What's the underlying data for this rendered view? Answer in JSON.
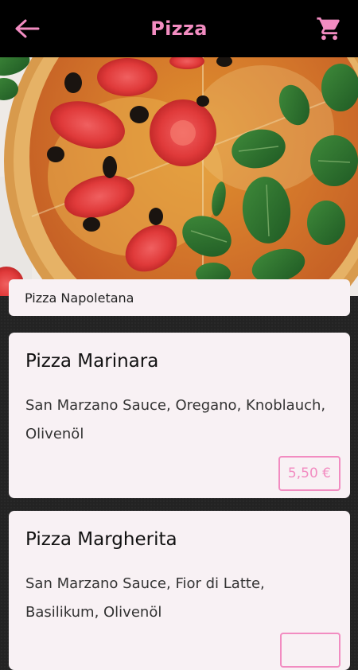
{
  "header": {
    "title": "Pizza",
    "back_icon": "arrow-left-icon",
    "cart_icon": "shopping-cart-icon",
    "accent_color": "#f28cc1"
  },
  "hero": {
    "caption": "Pizza Napoletana"
  },
  "menu": [
    {
      "name": "Pizza Marinara",
      "description": "San Marzano Sauce, Oregano, Knoblauch, Olivenöl",
      "price": "5,50 €"
    },
    {
      "name": "Pizza Margherita",
      "description": "San Marzano Sauce, Fior di Latte, Basilikum, Olivenöl",
      "price": ""
    }
  ]
}
